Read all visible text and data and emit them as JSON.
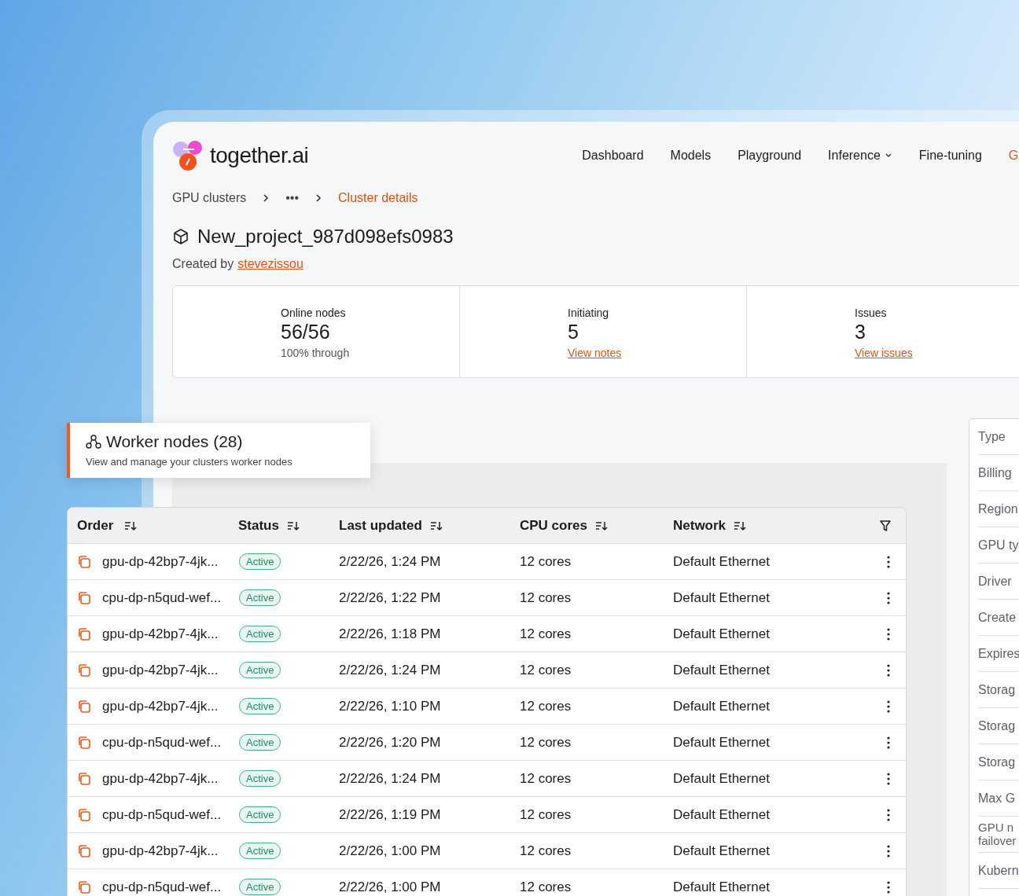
{
  "logo": {
    "text": "together.ai"
  },
  "nav": [
    {
      "label": "Dashboard",
      "selected": false,
      "dropdown": false
    },
    {
      "label": "Models",
      "selected": false,
      "dropdown": false
    },
    {
      "label": "Playground",
      "selected": false,
      "dropdown": false
    },
    {
      "label": "Inference",
      "selected": false,
      "dropdown": true
    },
    {
      "label": "Fine-tuning",
      "selected": false,
      "dropdown": false
    },
    {
      "label": "G",
      "selected": true,
      "dropdown": false
    }
  ],
  "breadcrumb": [
    {
      "label": "GPU clusters",
      "current": false
    },
    {
      "label": "•••",
      "current": false
    },
    {
      "label": "Cluster details",
      "current": true
    }
  ],
  "project": {
    "title": "New_project_987d098efs0983",
    "created_label": "Created by",
    "creator": "stevezissou"
  },
  "stats": [
    {
      "label": "Online nodes",
      "value": "56/56",
      "note": "100% through",
      "link": false
    },
    {
      "label": "Initiating",
      "value": "5",
      "note": "View notes",
      "link": true
    },
    {
      "label": "Issues",
      "value": "3",
      "note": "View issues",
      "link": true
    }
  ],
  "worker_nodes": {
    "title": "Worker nodes (28)",
    "subtitle": "View and manage your clusters worker nodes"
  },
  "table": {
    "columns": [
      "Order",
      "Status",
      "Last updated",
      "CPU cores",
      "Network"
    ],
    "rows": [
      {
        "order": "gpu-dp-42bp7-4jk...",
        "status": "Active",
        "updated": "2/22/26, 1:24 PM",
        "cpu": "12 cores",
        "network": "Default Ethernet"
      },
      {
        "order": "cpu-dp-n5qud-wef...",
        "status": "Active",
        "updated": "2/22/26, 1:22 PM",
        "cpu": "12 cores",
        "network": "Default Ethernet"
      },
      {
        "order": "gpu-dp-42bp7-4jk...",
        "status": "Active",
        "updated": "2/22/26, 1:18 PM",
        "cpu": "12 cores",
        "network": "Default Ethernet"
      },
      {
        "order": "gpu-dp-42bp7-4jk...",
        "status": "Active",
        "updated": "2/22/26, 1:24 PM",
        "cpu": "12 cores",
        "network": "Default Ethernet"
      },
      {
        "order": "gpu-dp-42bp7-4jk...",
        "status": "Active",
        "updated": "2/22/26, 1:10 PM",
        "cpu": "12 cores",
        "network": "Default Ethernet"
      },
      {
        "order": "cpu-dp-n5qud-wef...",
        "status": "Active",
        "updated": "2/22/26, 1:20 PM",
        "cpu": "12 cores",
        "network": "Default Ethernet"
      },
      {
        "order": "gpu-dp-42bp7-4jk...",
        "status": "Active",
        "updated": "2/22/26, 1:24 PM",
        "cpu": "12 cores",
        "network": "Default Ethernet"
      },
      {
        "order": "cpu-dp-n5qud-wef...",
        "status": "Active",
        "updated": "2/22/26, 1:19 PM",
        "cpu": "12 cores",
        "network": "Default Ethernet"
      },
      {
        "order": "gpu-dp-42bp7-4jk...",
        "status": "Active",
        "updated": "2/22/26, 1:00 PM",
        "cpu": "12 cores",
        "network": "Default Ethernet"
      },
      {
        "order": "cpu-dp-n5qud-wef...",
        "status": "Active",
        "updated": "2/22/26, 1:00 PM",
        "cpu": "12 cores",
        "network": "Default Ethernet"
      }
    ]
  },
  "details_panel": {
    "labels": [
      "Type",
      "Billing",
      "Region",
      "GPU ty",
      "Driver",
      "Create",
      "Expires",
      "Storag",
      "Storag",
      "Storag",
      "Max G",
      "GPU n failover",
      "Kubern"
    ]
  }
}
